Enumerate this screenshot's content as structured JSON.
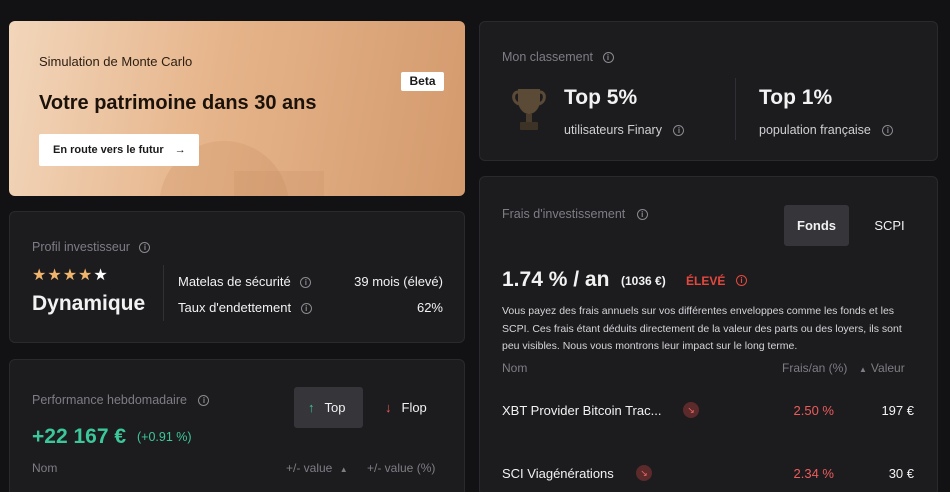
{
  "hero": {
    "subtitle": "Simulation de Monte Carlo",
    "badge": "Beta",
    "title": "Votre patrimoine dans 30 ans",
    "cta": "En route vers le futur",
    "cta_icon": "arrow-right-icon"
  },
  "ranking": {
    "label": "Mon classement",
    "items": [
      {
        "top": "Top",
        "value": "5%",
        "caption": "utilisateurs Finary"
      },
      {
        "top": "Top",
        "value": "1%",
        "caption": "population française"
      }
    ]
  },
  "profile": {
    "label": "Profil investisseur",
    "stars_filled": 4,
    "stars_total": 5,
    "type": "Dynamique",
    "rows": [
      {
        "label": "Matelas de sécurité",
        "value": "39 mois (élevé)"
      },
      {
        "label": "Taux d'endettement",
        "value": "62%"
      }
    ]
  },
  "performance": {
    "label": "Performance hebdomadaire",
    "value": "+22 167 €",
    "percent": "(+0.91 %)",
    "tabs": [
      {
        "label": "Top",
        "active": true
      },
      {
        "label": "Flop",
        "active": false
      }
    ],
    "columns": [
      "Nom",
      "+/- value",
      "+/- value (%)"
    ]
  },
  "fees": {
    "label": "Frais d'investissement",
    "tabs": [
      {
        "label": "Fonds",
        "active": true
      },
      {
        "label": "SCPI",
        "active": false
      }
    ],
    "rate": "1.74 %",
    "per": "/ an",
    "amount": "(1036 €)",
    "level": "ÉLEVÉ",
    "description": "Vous payez des frais annuels sur vos différentes enveloppes comme les fonds et les SCPI. Ces frais étant déduits directement de la valeur des parts ou des loyers, ils sont peu visibles. Nous vous montrons leur impact sur le long terme.",
    "columns": [
      "Nom",
      "Frais/an (%)",
      "Valeur"
    ],
    "funds": [
      {
        "name": "XBT Provider Bitcoin Trac...",
        "fee": "2.50 %",
        "value": "197 €"
      },
      {
        "name": "SCI Viagénérations",
        "fee": "2.34 %",
        "value": "30 €"
      }
    ]
  },
  "colors": {
    "background": "#121214",
    "card": "#1c1c1f",
    "positive": "#3cc79a",
    "negative": "#ee5b5b",
    "star": "#f0b56c"
  }
}
